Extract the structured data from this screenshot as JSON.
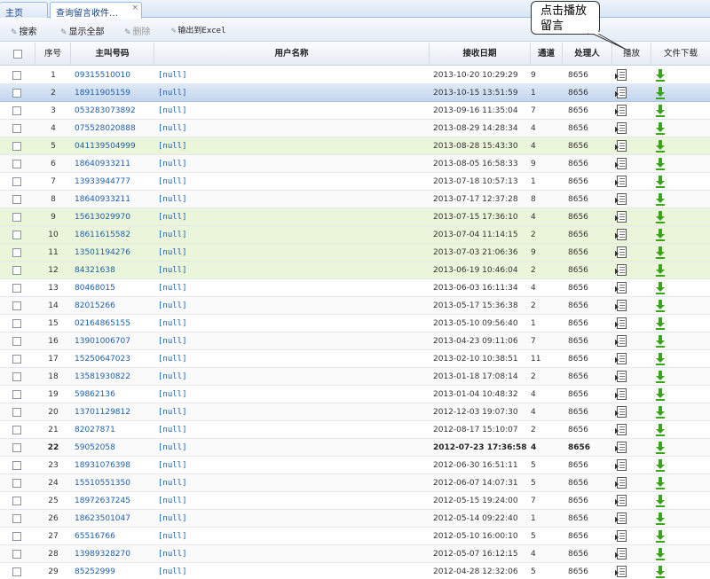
{
  "tabs": {
    "home": "主页",
    "active": "查询留言收件…",
    "close": "×"
  },
  "toolbar": {
    "search": "搜索",
    "show_all": "显示全部",
    "delete": "删除",
    "export": "输出到Excel"
  },
  "callout": {
    "line1": "点击播放",
    "line2": "留言"
  },
  "columns": {
    "no": "序号",
    "caller": "主叫号码",
    "username": "用户名称",
    "date": "接收日期",
    "channel": "通道",
    "operator": "处理人",
    "play": "播放",
    "download": "文件下载"
  },
  "rows": [
    {
      "no": "1",
      "caller": "09315510010",
      "name": "[null]",
      "date": "2013-10-20 10:29:29",
      "channel": "9",
      "operator": "8656"
    },
    {
      "no": "2",
      "caller": "18911905159",
      "name": "[null]",
      "date": "2013-10-15 13:51:59",
      "channel": "1",
      "operator": "8656"
    },
    {
      "no": "3",
      "caller": "053283073892",
      "name": "[null]",
      "date": "2013-09-16 11:35:04",
      "channel": "7",
      "operator": "8656"
    },
    {
      "no": "4",
      "caller": "075528020888",
      "name": "[null]",
      "date": "2013-08-29 14:28:34",
      "channel": "4",
      "operator": "8656"
    },
    {
      "no": "5",
      "caller": "041139504999",
      "name": "[null]",
      "date": "2013-08-28 15:43:30",
      "channel": "4",
      "operator": "8656"
    },
    {
      "no": "6",
      "caller": "18640933211",
      "name": "[null]",
      "date": "2013-08-05 16:58:33",
      "channel": "9",
      "operator": "8656"
    },
    {
      "no": "7",
      "caller": "13933944777",
      "name": "[null]",
      "date": "2013-07-18 10:57:13",
      "channel": "1",
      "operator": "8656"
    },
    {
      "no": "8",
      "caller": "18640933211",
      "name": "[null]",
      "date": "2013-07-17 12:37:28",
      "channel": "8",
      "operator": "8656"
    },
    {
      "no": "9",
      "caller": "15613029970",
      "name": "[null]",
      "date": "2013-07-15 17:36:10",
      "channel": "4",
      "operator": "8656"
    },
    {
      "no": "10",
      "caller": "18611615582",
      "name": "[null]",
      "date": "2013-07-04 11:14:15",
      "channel": "2",
      "operator": "8656"
    },
    {
      "no": "11",
      "caller": "13501194276",
      "name": "[null]",
      "date": "2013-07-03 21:06:36",
      "channel": "9",
      "operator": "8656"
    },
    {
      "no": "12",
      "caller": "84321638",
      "name": "[null]",
      "date": "2013-06-19 10:46:04",
      "channel": "2",
      "operator": "8656"
    },
    {
      "no": "13",
      "caller": "80468015",
      "name": "[null]",
      "date": "2013-06-03 16:11:34",
      "channel": "4",
      "operator": "8656"
    },
    {
      "no": "14",
      "caller": "82015266",
      "name": "[null]",
      "date": "2013-05-17 15:36:38",
      "channel": "2",
      "operator": "8656"
    },
    {
      "no": "15",
      "caller": "02164865155",
      "name": "[null]",
      "date": "2013-05-10 09:56:40",
      "channel": "1",
      "operator": "8656"
    },
    {
      "no": "16",
      "caller": "13901006707",
      "name": "[null]",
      "date": "2013-04-23 09:11:06",
      "channel": "7",
      "operator": "8656"
    },
    {
      "no": "17",
      "caller": "15250647023",
      "name": "[null]",
      "date": "2013-02-10 10:38:51",
      "channel": "11",
      "operator": "8656"
    },
    {
      "no": "18",
      "caller": "13581930822",
      "name": "[null]",
      "date": "2013-01-18 17:08:14",
      "channel": "2",
      "operator": "8656"
    },
    {
      "no": "19",
      "caller": "59862136",
      "name": "[null]",
      "date": "2013-01-04 10:48:32",
      "channel": "4",
      "operator": "8656"
    },
    {
      "no": "20",
      "caller": "13701129812",
      "name": "[null]",
      "date": "2012-12-03 19:07:30",
      "channel": "4",
      "operator": "8656"
    },
    {
      "no": "21",
      "caller": "82027871",
      "name": "[null]",
      "date": "2012-08-17 15:10:07",
      "channel": "2",
      "operator": "8656"
    },
    {
      "no": "22",
      "caller": "59052058",
      "name": "[null]",
      "date": "2012-07-23 17:36:58",
      "channel": "4",
      "operator": "8656"
    },
    {
      "no": "23",
      "caller": "18931076398",
      "name": "[null]",
      "date": "2012-06-30 16:51:11",
      "channel": "5",
      "operator": "8656"
    },
    {
      "no": "24",
      "caller": "15510551350",
      "name": "[null]",
      "date": "2012-06-07 14:07:31",
      "channel": "5",
      "operator": "8656"
    },
    {
      "no": "25",
      "caller": "18972637245",
      "name": "[null]",
      "date": "2012-05-15 19:24:00",
      "channel": "7",
      "operator": "8656"
    },
    {
      "no": "26",
      "caller": "18623501047",
      "name": "[null]",
      "date": "2012-05-14 09:22:40",
      "channel": "1",
      "operator": "8656"
    },
    {
      "no": "27",
      "caller": "65516766",
      "name": "[null]",
      "date": "2012-05-10 16:00:10",
      "channel": "5",
      "operator": "8656"
    },
    {
      "no": "28",
      "caller": "13989328270",
      "name": "[null]",
      "date": "2012-05-07 16:12:15",
      "channel": "4",
      "operator": "8656"
    },
    {
      "no": "29",
      "caller": "85252999",
      "name": "[null]",
      "date": "2012-04-28 12:32:06",
      "channel": "5",
      "operator": "8656"
    }
  ],
  "colors": {
    "link": "#1f5fa8",
    "selected_row": "#c3d6ee",
    "highlight_row": "#eaf5da",
    "download_arrow": "#3aa51c"
  },
  "icons": {
    "play": "play-message-icon",
    "download": "download-arrow-icon"
  }
}
